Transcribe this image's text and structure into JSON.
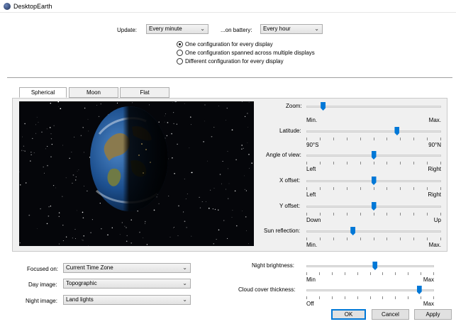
{
  "window": {
    "title": "DesktopEarth"
  },
  "update": {
    "label": "Update:",
    "value": "Every minute",
    "battery_label": "...on battery:",
    "battery_value": "Every hour"
  },
  "display_config": {
    "options": [
      "One configuration for every display",
      "One configuration spanned across multiple displays",
      "Different configuration for every display"
    ],
    "selected_index": 0
  },
  "tabs": [
    "Spherical",
    "Moon",
    "Flat"
  ],
  "active_tab": "Spherical",
  "sliders": {
    "zoom": {
      "label": "Zoom:",
      "min": "Min.",
      "max": "Max.",
      "value": 0.11
    },
    "latitude": {
      "label": "Latitude:",
      "min": "90°S",
      "max": "90°N",
      "value": 0.68
    },
    "angle": {
      "label": "Angle of view:",
      "min": "Left",
      "max": "Right",
      "value": 0.5
    },
    "x_offset": {
      "label": "X offset:",
      "min": "Left",
      "max": "Right",
      "value": 0.5
    },
    "y_offset": {
      "label": "Y offset:",
      "min": "Down",
      "max": "Up",
      "value": 0.5
    },
    "sun_reflection": {
      "label": "Sun reflection:",
      "min": "Min.",
      "max": "Max.",
      "value": 0.34
    },
    "night_brightness": {
      "label": "Night brightness:",
      "min": "Min",
      "max": "Max",
      "value": 0.54
    },
    "cloud_cover": {
      "label": "Cloud cover thickness:",
      "min": "Off",
      "max": "Max",
      "value": 0.9
    }
  },
  "focused_on": {
    "label": "Focused on:",
    "value": "Current Time Zone"
  },
  "day_image": {
    "label": "Day image:",
    "value": "Topographic"
  },
  "night_image": {
    "label": "Night image:",
    "value": "Land lights"
  },
  "buttons": {
    "ok": "OK",
    "cancel": "Cancel",
    "apply": "Apply"
  },
  "colors": {
    "accent": "#0078d7",
    "panel": "#f0f0f0"
  }
}
